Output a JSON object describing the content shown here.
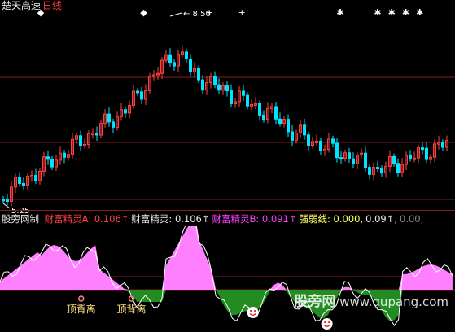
{
  "title": {
    "name": "楚天高速",
    "period": "日线"
  },
  "price_chart": {
    "high_label": "8.50",
    "low_label": "5.25",
    "markers": [
      {
        "type": "diamond",
        "index": 8
      },
      {
        "type": "diamond",
        "index": 30
      },
      {
        "type": "cross",
        "index": 44
      },
      {
        "type": "cross",
        "index": 51
      },
      {
        "type": "star",
        "index": 72
      },
      {
        "type": "star",
        "index": 80
      },
      {
        "type": "star",
        "index": 83
      },
      {
        "type": "star",
        "index": 86
      },
      {
        "type": "star",
        "index": 89
      }
    ],
    "colors": {
      "up": "#ff4040",
      "down": "#00e5ff",
      "grid": "#8b1a1a"
    }
  },
  "indicator_bar": {
    "tool_name": "股旁网制",
    "items": [
      {
        "label": "财富精灵A:",
        "value": "0.106",
        "arrow": "↑",
        "color": "#ff4040"
      },
      {
        "label": "财富精灵:",
        "value": "0.106",
        "arrow": "↑",
        "color": "#e8e8e8"
      },
      {
        "label": "财富精灵B:",
        "value": "0.091",
        "arrow": "↑",
        "color": "#ff40ff"
      },
      {
        "label": "强弱线:",
        "value": "0.000,",
        "arrow": "",
        "color": "#ffff60"
      },
      {
        "label": "",
        "value": "0.09",
        "arrow": "↑,",
        "color": "#e8e8e8"
      },
      {
        "label": "",
        "value": "0.00,",
        "arrow": "",
        "color": "#888888"
      }
    ]
  },
  "indicator_chart": {
    "signals": [
      {
        "text": "顶背离",
        "index": 16
      },
      {
        "text": "顶背离",
        "index": 27
      }
    ],
    "smileys": [
      {
        "index": 58
      },
      {
        "index": 75
      }
    ],
    "colors": {
      "positive": "#ff80ff",
      "negative": "#228b22",
      "line": "#ffffff"
    }
  },
  "watermark": {
    "text": "股旁网",
    "url": "www.gupang.com"
  }
}
